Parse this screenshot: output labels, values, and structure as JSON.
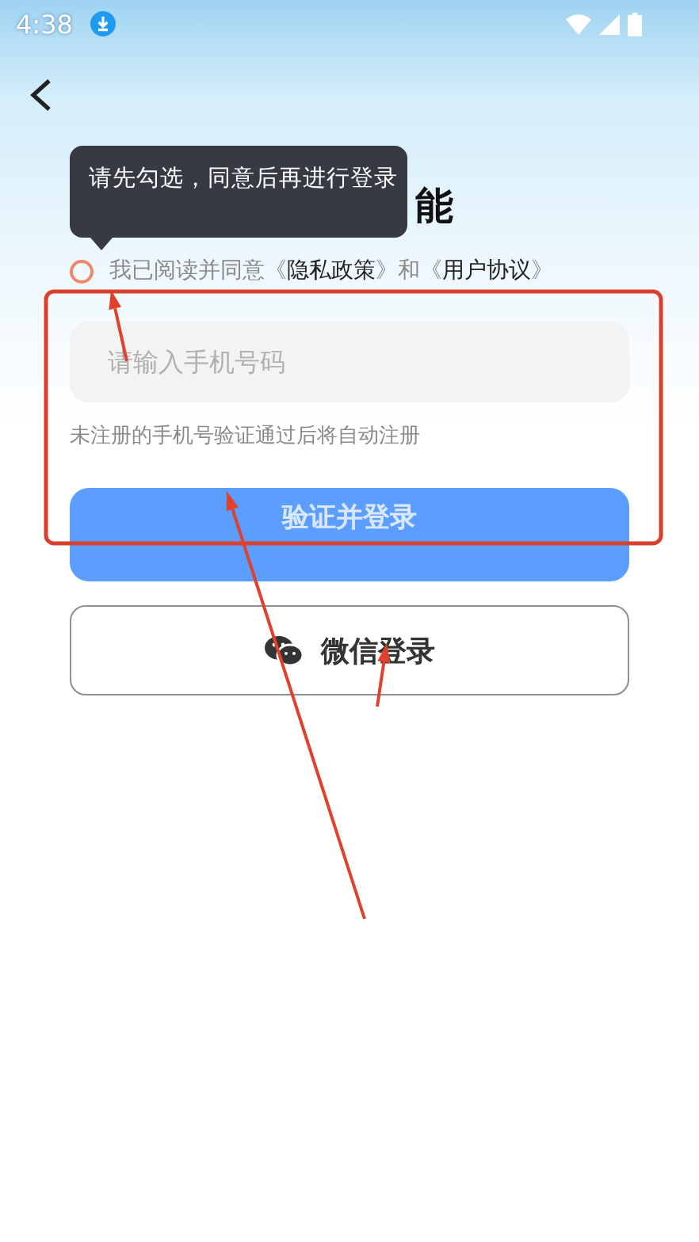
{
  "status_bar": {
    "time": "4:38"
  },
  "tooltip": {
    "text": "请先勾选，同意后再进行登录"
  },
  "title": "能",
  "agreement": {
    "checked": false,
    "parts": [
      {
        "text": "我已阅读并同意《",
        "kind": "plain"
      },
      {
        "text": "隐私政策",
        "kind": "link"
      },
      {
        "text": "》和《",
        "kind": "plain"
      },
      {
        "text": "用户协议",
        "kind": "link"
      },
      {
        "text": "》",
        "kind": "plain"
      }
    ]
  },
  "phone_field": {
    "placeholder": "请输入手机号码"
  },
  "hint": "未注册的手机号验证通过后将自动注册",
  "verify_button": {
    "label": "验证并登录",
    "disabled": true
  },
  "wechat_button": {
    "label": "微信登录"
  }
}
